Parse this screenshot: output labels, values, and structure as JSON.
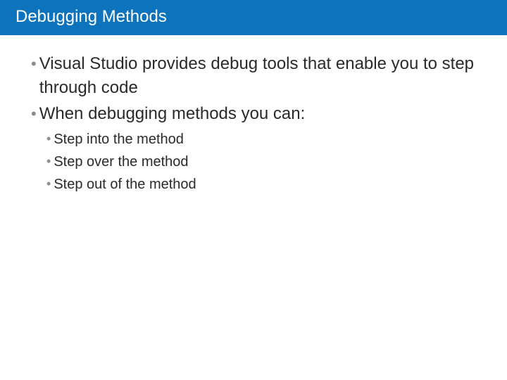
{
  "title": "Debugging Methods",
  "bullets": {
    "b1": "Visual Studio provides debug tools that enable you to step through code",
    "b2": "When debugging methods you can:",
    "sub1": "Step into the method",
    "sub2": "Step over the method",
    "sub3": "Step out of the method"
  }
}
